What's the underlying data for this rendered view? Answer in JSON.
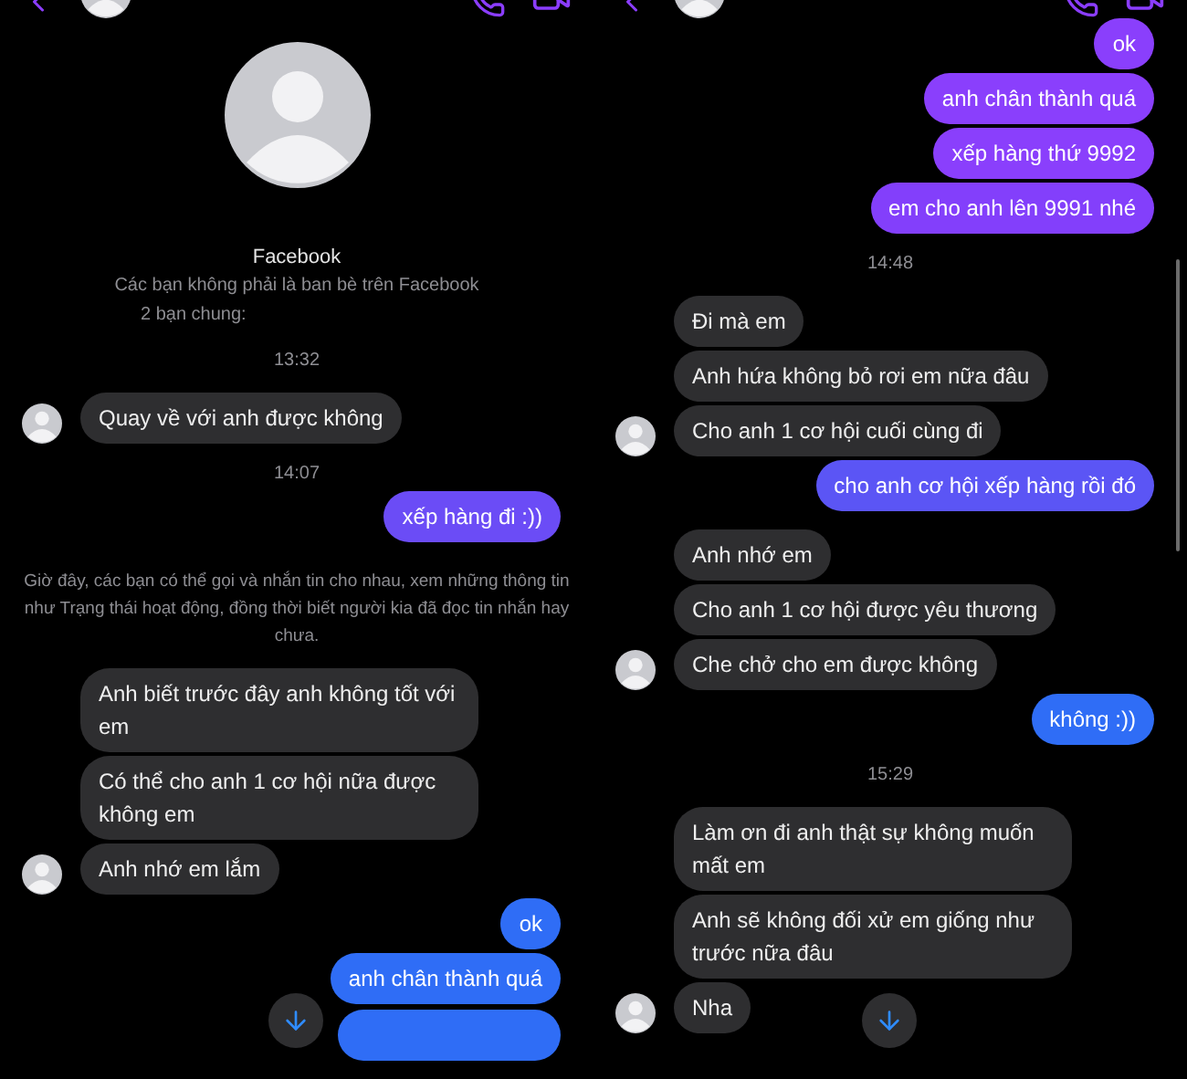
{
  "panels": [
    {
      "profile": {
        "name": "Facebook",
        "subtitle": "Các bạn không phải là ban bè trên Facebook",
        "mutual": "2 bạn chung:"
      },
      "messages": [
        {
          "kind": "time",
          "text": "13:32"
        },
        {
          "kind": "received",
          "texts": [
            "Quay về với anh được không"
          ]
        },
        {
          "kind": "time",
          "text": "14:07"
        },
        {
          "kind": "sent",
          "text": "xếp hàng đi :))",
          "color": "#6b4cf6"
        },
        {
          "kind": "notice",
          "text": "Giờ đây, các bạn có thể gọi và nhắn tin cho nhau, xem những thông tin như Trạng thái hoạt động, đồng thời biết người kia đã đọc tin nhắn hay chưa."
        },
        {
          "kind": "received",
          "texts": [
            "Anh biết trước đây anh không tốt với em",
            "Có thể cho anh 1 cơ hội nữa được không em",
            "Anh nhớ em lắm"
          ]
        },
        {
          "kind": "sent",
          "text": "ok",
          "color": "#2f6df6"
        },
        {
          "kind": "sent",
          "text": "anh chân thành quá",
          "color": "#2f6df6"
        },
        {
          "kind": "sent_cut",
          "color": "#2f6df6"
        }
      ]
    },
    {
      "messages": [
        {
          "kind": "sent",
          "text": "ok",
          "color": "#8a3ffc"
        },
        {
          "kind": "sent",
          "text": "anh chân thành quá",
          "color": "#8a3ffc"
        },
        {
          "kind": "sent",
          "text": "xếp hàng thứ 9992",
          "color": "#8a3ffc"
        },
        {
          "kind": "sent",
          "text": "em cho anh lên 9991 nhé",
          "color": "#833ffb"
        },
        {
          "kind": "time",
          "text": "14:48"
        },
        {
          "kind": "received",
          "texts": [
            "Đi mà em",
            "Anh hứa không bỏ rơi em nữa đâu",
            "Cho anh 1 cơ hội cuối cùng đi"
          ]
        },
        {
          "kind": "sent",
          "text": "cho anh cơ hội xếp hàng rồi đó",
          "color": "#5b55f5"
        },
        {
          "kind": "received",
          "texts": [
            "Anh nhớ em",
            "Cho anh 1 cơ hội được yêu thương",
            "Che chở cho em được không"
          ]
        },
        {
          "kind": "sent",
          "text": "không :))",
          "color": "#2f6df6"
        },
        {
          "kind": "time",
          "text": "15:29"
        },
        {
          "kind": "received",
          "texts": [
            "Làm ơn đi anh thật sự không muốn mất em",
            "Anh sẽ không đối xử em giống như trước nữa đâu",
            "Nha"
          ]
        }
      ],
      "scrollbar": true
    }
  ]
}
